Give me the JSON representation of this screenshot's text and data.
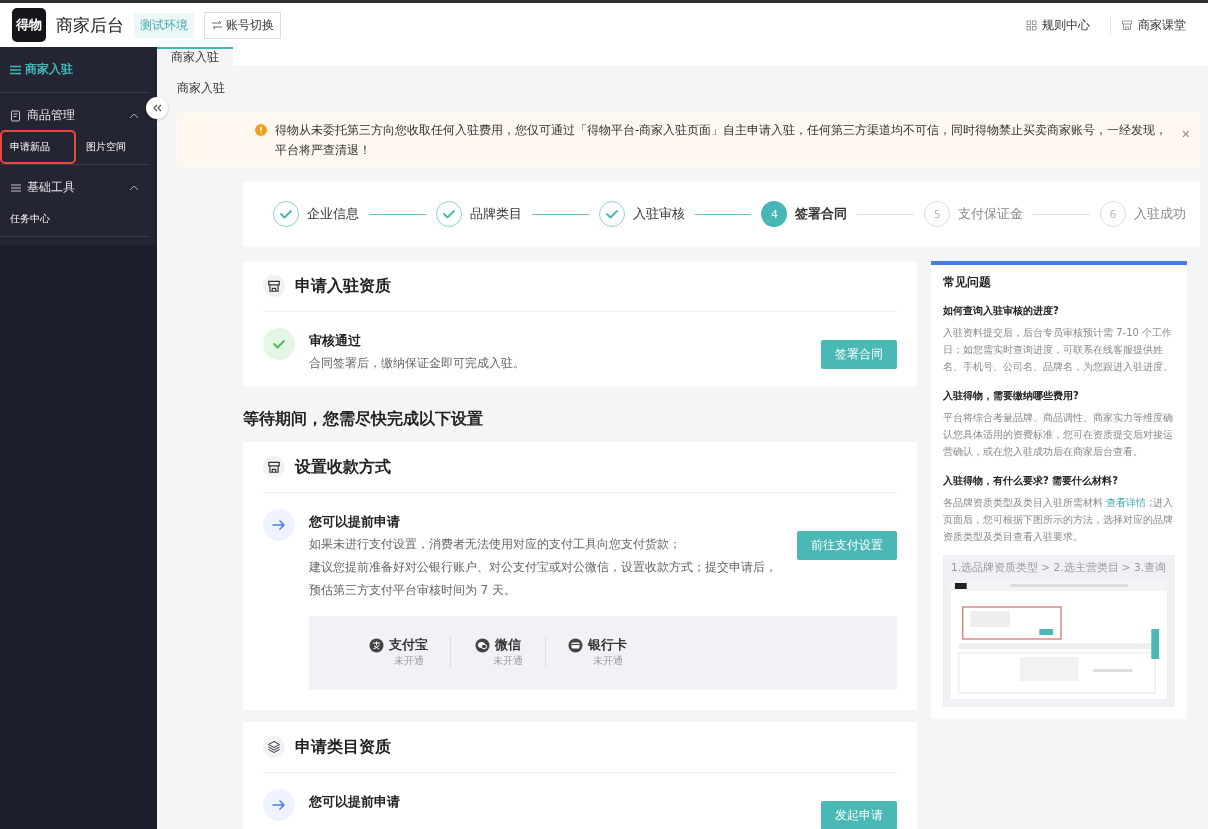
{
  "header": {
    "logo": "得物",
    "title": "商家后台",
    "env_badge": "测试环境",
    "switch_button": "账号切换",
    "links": [
      {
        "label": "规则中心",
        "kind": "grid"
      },
      {
        "label": "商家课堂",
        "kind": "store"
      }
    ]
  },
  "sidebar": {
    "title": "商家入驻",
    "groups": [
      {
        "label": "商品管理",
        "kind": "doc",
        "expanded": true,
        "items": [
          {
            "label": "申请新品",
            "selected": true
          },
          {
            "label": "图片空间",
            "selected": false
          }
        ]
      },
      {
        "label": "基础工具",
        "kind": "list",
        "expanded": true,
        "items": [
          {
            "label": "任务中心",
            "selected": false
          }
        ]
      }
    ]
  },
  "tabs": [
    {
      "label": "商家入驻",
      "selected": true
    }
  ],
  "breadcrumb": "商家入驻",
  "alert": {
    "text": "得物从未委托第三方向您收取任何入驻费用，您仅可通过「得物平台-商家入驻页面」自主申请入驻，任何第三方渠道均不可信，同时得物禁止买卖商家账号，一经发现，平台将严查清退！",
    "close": "×"
  },
  "steps": [
    {
      "label": "企业信息",
      "completed": true,
      "current": false
    },
    {
      "label": "品牌类目",
      "completed": true,
      "current": false
    },
    {
      "label": "入驻审核",
      "completed": true,
      "current": false
    },
    {
      "number": "4",
      "label": "签署合同",
      "completed": false,
      "current": true
    },
    {
      "number": "5",
      "label": "支付保证金",
      "completed": false,
      "current": false
    },
    {
      "number": "6",
      "label": "入驻成功",
      "completed": false,
      "current": false
    }
  ],
  "qualification_card": {
    "title": "申请入驻资质",
    "status_title": "审核通过",
    "status_text": "合同签署后，缴纳保证金即可完成入驻。",
    "button": "签署合同"
  },
  "section_heading": "等待期间，您需尽快完成以下设置",
  "payment_card": {
    "title": "设置收款方式",
    "subtitle": "您可以提前申请",
    "lines": [
      "如果未进行支付设置，消费者无法使用对应的支付工具向您支付货款；",
      "建议您提前准备好对公银行账户、对公支付宝或对公微信，设置收款方式；提交申请后，",
      "预估第三方支付平台审核时间为 7 天。"
    ],
    "button": "前往支付设置",
    "methods": [
      {
        "name": "支付宝",
        "status": "未开通",
        "kind": "alipay"
      },
      {
        "name": "微信",
        "status": "未开通",
        "kind": "wechat"
      },
      {
        "name": "银行卡",
        "status": "未开通",
        "kind": "card"
      }
    ]
  },
  "category_card": {
    "title": "申请类目资质",
    "subtitle": "您可以提前申请",
    "button": "发起申请"
  },
  "faq": {
    "title": "常见问题",
    "items": [
      {
        "question": "如何查询入驻审核的进度?",
        "answer": "入驻资料提交后，后台专员审核预计需 7-10 个工作日；如您需实时查询进度，可联系在线客服提供姓名、手机号、公司名、品牌名，为您跟进入驻进度。"
      },
      {
        "question": "入驻得物，需要缴纳哪些费用?",
        "answer": "平台将综合考量品牌、商品调性、商家实力等维度确认您具体适用的资费标准，您可在资质提交后对接运营确认，或在您入驻成功后在商家后台查看。"
      },
      {
        "question": "入驻得物，有什么要求? 需要什么材料?",
        "answer_before": "各品牌资质类型及类目入驻所需材料 ",
        "link": "查看详情",
        "answer_after": " ;进入页面后，您可根据下图所示的方法，选择对应的品牌资质类型及类目查看入驻要求。"
      }
    ],
    "guide_title": "1.选品牌资质类型 > 2.选主营类目 > 3.查询"
  }
}
